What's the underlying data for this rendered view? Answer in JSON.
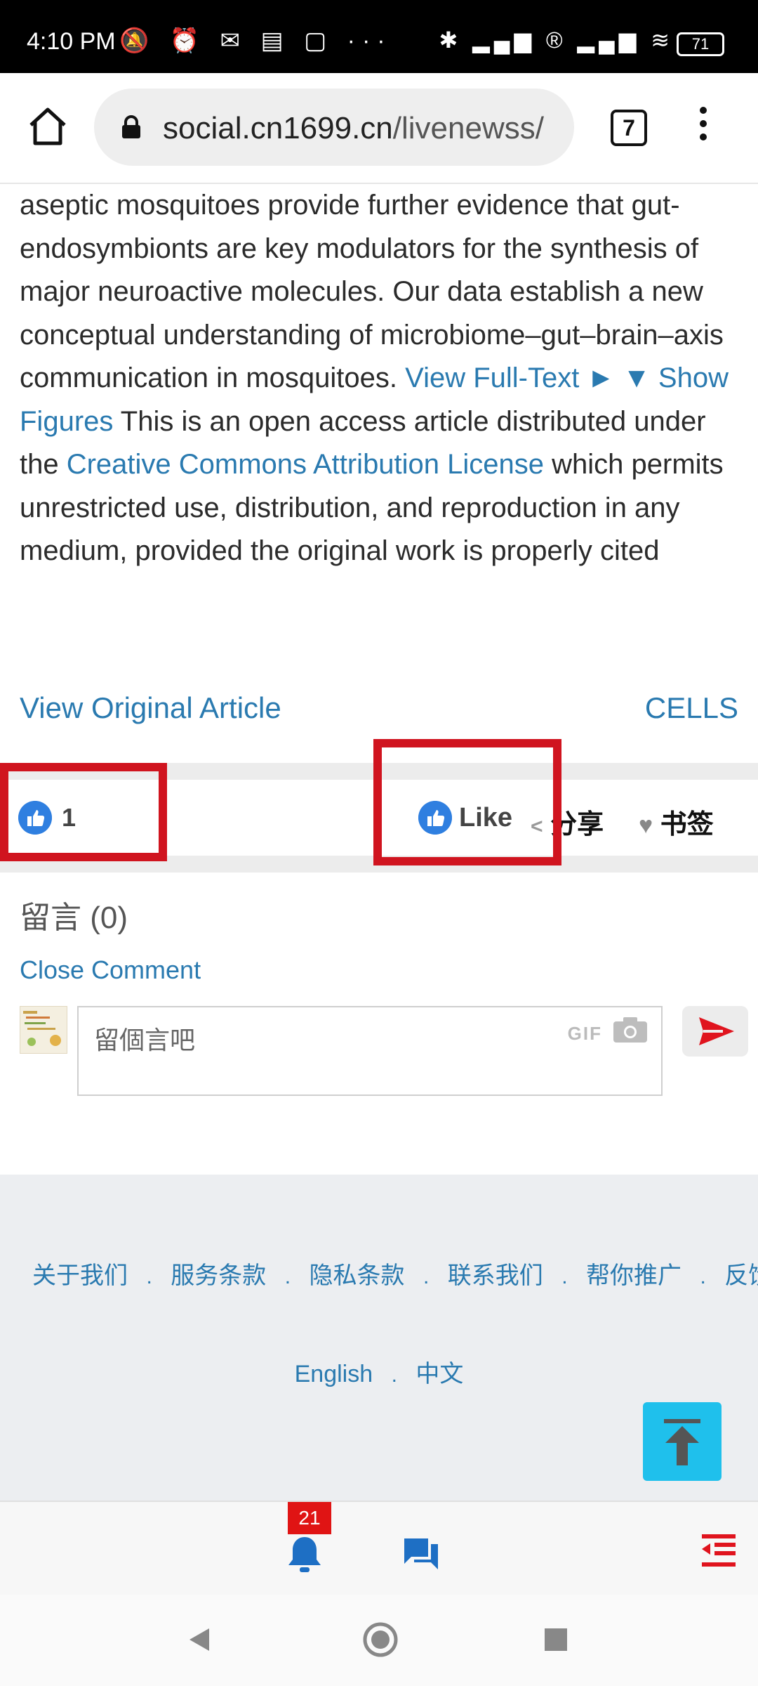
{
  "status_bar": {
    "time": "4:10 PM",
    "left_icons": "🔕 ⏰ ✉ ▤ ▢ ···",
    "right_icons": "✱ ▂▄▆ ® ▂▄▆ ≋",
    "battery": "71"
  },
  "browser": {
    "url_domain": "social.cn1699.cn",
    "url_path": "/livenewss/",
    "tab_count": "7"
  },
  "article": {
    "text_1": "aseptic mosquitoes provide further evidence that gut-endosymbionts are key modulators for the synthesis of major neuroactive molecules. Our data establish a new conceptual understanding of microbiome–gut–brain–axis communication in mosquitoes. ",
    "view_fulltext": "View Full-Text ►",
    "show_figures": "▼ Show Figures",
    "text_2": " This is an open access article distributed under the ",
    "license_link": "Creative Commons Attribution License",
    "text_3": " which permits unrestricted use, distribution, and reproduction in any medium, provided the original work is properly cited",
    "view_original": "View Original Article",
    "journal": "CELLS"
  },
  "actions": {
    "like_count": "1",
    "like_label": "Like",
    "share_label": "分享",
    "bookmark_label": "书签",
    "highlight_color": "#d0141f",
    "like_color": "#2f7fe0"
  },
  "comments": {
    "title": "留言 (0)",
    "close_label": "Close Comment",
    "placeholder": "留個言吧",
    "gif_label": "GIF"
  },
  "footer": {
    "links": [
      "关于我们",
      "服务条款",
      "隐私条款",
      "联系我们",
      "帮你推广",
      "反馈"
    ],
    "sep": ".",
    "lang_en": "English",
    "lang_zh": "中文"
  },
  "bottom_nav": {
    "notification_badge": "21"
  },
  "colors": {
    "link": "#2a7ab0",
    "accent": "#1fc0ec",
    "send": "#e0141e"
  }
}
